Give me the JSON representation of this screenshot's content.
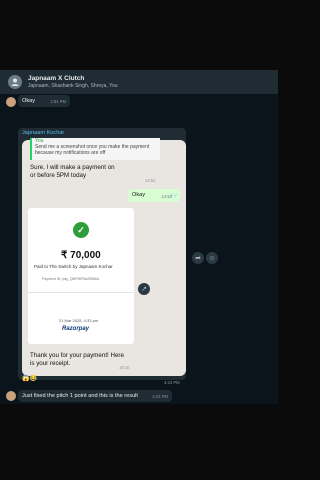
{
  "header": {
    "title": "Japnaam X Clutch",
    "subtitle": "Japnaam, Shashank Singh, Shreya, You"
  },
  "messages": {
    "top_in": {
      "text": "Okay",
      "time": "1:54 PM"
    },
    "payment_sender": "Japnaam Kochar",
    "quoted": {
      "name": "You",
      "text": "Send me a screenshot once you make the payment because my notifications are off"
    },
    "reply_text": "Sure, I will make a payment on or before 5PM today",
    "reply_time": "14:52",
    "okay_out": {
      "text": "Okay",
      "time": "14:53"
    },
    "receipt": {
      "amount": "₹ 70,000",
      "paid_to": "Paid to The Switch by Japnaam Kochar",
      "payment_id": "Payment ID: pay_QMPWPdkAR6NIu",
      "date": "21 Mar 2025, 4:33 pm",
      "brand": "Razorpay"
    },
    "thanks_text": "Thank you for your payment! Here is your receipt.",
    "thanks_time": "16:10",
    "card_time": "4:24 PM",
    "reaction_emojis": "😱😂",
    "bottom_in": {
      "text": "Just fixed the pitch 1 point and this is the result",
      "time": "4:24 PM"
    }
  },
  "icons": {
    "forward": "share-arrow-icon",
    "reply": "emoji-reply-icon",
    "check": "checkmark-icon"
  }
}
